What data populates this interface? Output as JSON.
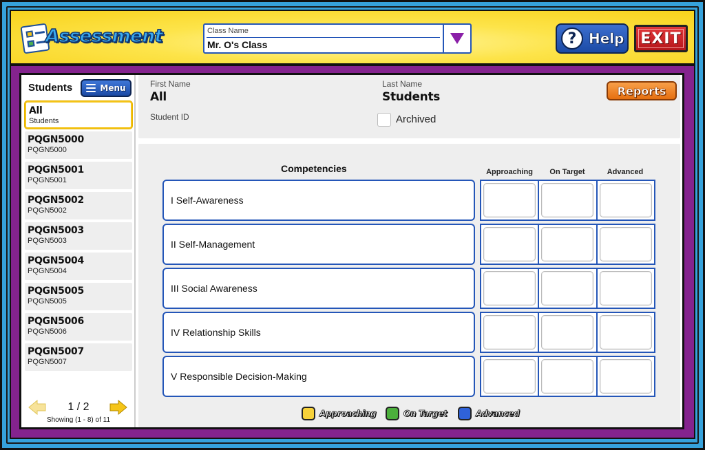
{
  "header": {
    "app_title": "Assessment",
    "class_select": {
      "label": "Class Name",
      "value": "Mr. O's Class"
    },
    "help_label": "Help",
    "exit_label": "EXIT"
  },
  "sidebar": {
    "title": "Students",
    "menu_label": "Menu",
    "items": [
      {
        "name": "All",
        "sub": "Students"
      },
      {
        "name": "PQGN5000",
        "sub": "PQGN5000"
      },
      {
        "name": "PQGN5001",
        "sub": "PQGN5001"
      },
      {
        "name": "PQGN5002",
        "sub": "PQGN5002"
      },
      {
        "name": "PQGN5003",
        "sub": "PQGN5003"
      },
      {
        "name": "PQGN5004",
        "sub": "PQGN5004"
      },
      {
        "name": "PQGN5005",
        "sub": "PQGN5005"
      },
      {
        "name": "PQGN5006",
        "sub": "PQGN5006"
      },
      {
        "name": "PQGN5007",
        "sub": "PQGN5007"
      }
    ],
    "pager": {
      "page": "1 / 2",
      "showing": "Showing (1 - 8) of 11"
    }
  },
  "student_info": {
    "first_name_label": "First Name",
    "first_name_value": "All",
    "last_name_label": "Last Name",
    "last_name_value": "Students",
    "student_id_label": "Student ID",
    "archived_label": "Archived",
    "reports_label": "Reports"
  },
  "competencies": {
    "title": "Competencies",
    "columns": [
      "Approaching",
      "On Target",
      "Advanced"
    ],
    "rows": [
      "I Self-Awareness",
      "II Self-Management",
      "III Social Awareness",
      "IV Relationship Skills",
      "V Responsible Decision-Making"
    ],
    "legend": [
      {
        "label": "Approaching",
        "color": "#f7d23a"
      },
      {
        "label": "On Target",
        "color": "#4caf3c"
      },
      {
        "label": "Advanced",
        "color": "#2f62d9"
      }
    ]
  },
  "colors": {
    "frame_blue": "#36a2dc",
    "header_yellow": "#fde44a",
    "panel_purple": "#84238e",
    "accent_blue": "#2456b8",
    "exit_red": "#c8202a",
    "reports_orange": "#ee8327"
  }
}
